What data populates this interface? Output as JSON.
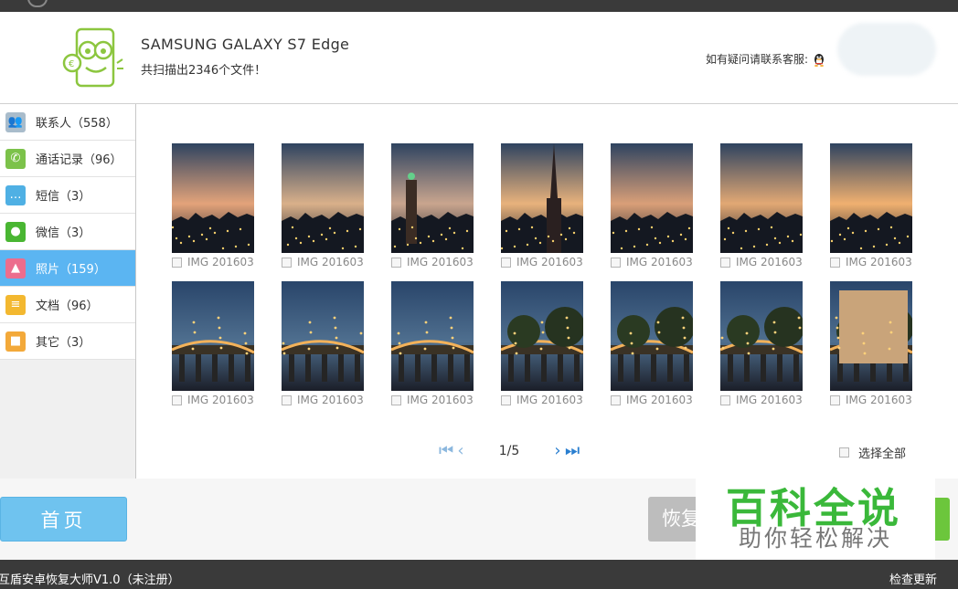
{
  "header": {
    "device_name": "SAMSUNG  GALAXY S7 Edge",
    "scan_count": "共扫描出2346个文件！",
    "service_text": "如有疑问请联系客服:"
  },
  "sidebar": {
    "items": [
      {
        "label": "联系人（558）",
        "icon": "contacts-icon",
        "color": "#a9bccb"
      },
      {
        "label": "通话记录（96）",
        "icon": "call-log-icon",
        "color": "#7cc24a"
      },
      {
        "label": "短信（3）",
        "icon": "sms-icon",
        "color": "#4fb0e4"
      },
      {
        "label": "微信（3）",
        "icon": "wechat-icon",
        "color": "#49b632"
      },
      {
        "label": "照片（159）",
        "icon": "photo-icon",
        "color": "#ec6d8d"
      },
      {
        "label": "文档（96）",
        "icon": "document-icon",
        "color": "#f3b830"
      },
      {
        "label": "其它（3）",
        "icon": "other-icon",
        "color": "#f3a93a"
      }
    ],
    "active_index": 4
  },
  "photos": {
    "items": [
      {
        "name": "IMG 201603..."
      },
      {
        "name": "IMG 201603..."
      },
      {
        "name": "IMG 201603..."
      },
      {
        "name": "IMG 201603..."
      },
      {
        "name": "IMG 201603..."
      },
      {
        "name": "IMG 201603..."
      },
      {
        "name": "IMG 201603..."
      },
      {
        "name": "IMG 201603..."
      },
      {
        "name": "IMG 201603..."
      },
      {
        "name": "IMG 201603..."
      },
      {
        "name": "IMG 201603..."
      },
      {
        "name": "IMG 201603..."
      },
      {
        "name": "IMG 201603..."
      },
      {
        "name": "IMG 201603..."
      }
    ]
  },
  "pagination": {
    "page_text": "1/5",
    "select_all": "选择全部"
  },
  "actions": {
    "home": "首页",
    "recover": "恢复"
  },
  "watermark": {
    "big": "百科全说",
    "small": "助你轻松解决"
  },
  "statusbar": {
    "title": "互盾安卓恢复大师V1.0（未注册）",
    "update": "检查更新"
  },
  "colors": {
    "accent": "#5bb5f2",
    "home_button": "#6fc3ef",
    "dark_bar": "#3a3a3a"
  }
}
